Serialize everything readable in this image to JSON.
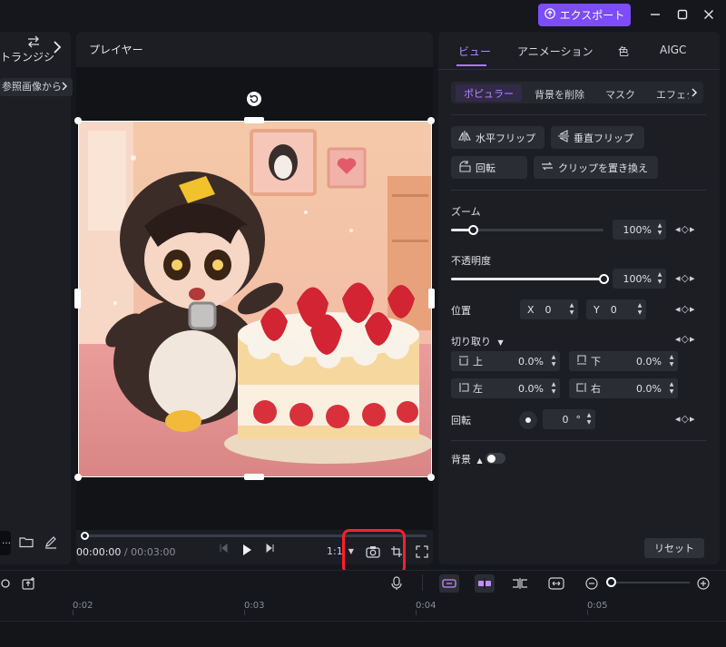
{
  "window": {
    "export_label": "エクスポート",
    "colors": {
      "accent": "#7c4dff",
      "tab_accent": "#b08cff",
      "highlight_box": "#ff1f2a"
    }
  },
  "left": {
    "transition_label": "トランジシ",
    "ref_chip": "参照画像から"
  },
  "player": {
    "title": "プレイヤー",
    "time_current": "00:00:00",
    "time_sep": "/",
    "time_total": "00:03:00",
    "ratio": "1:1",
    "scrub_progress": 0
  },
  "inspector": {
    "tabs": [
      "ビュー",
      "アニメーション",
      "色",
      "AIGC"
    ],
    "subtabs": [
      "ポピュラー",
      "背景を削除",
      "マスク",
      "エフェク"
    ],
    "buttons": {
      "flip_h": "水平フリップ",
      "flip_v": "垂直フリップ",
      "rotate": "回転",
      "replace_clip": "クリップを置き換え"
    },
    "zoom": {
      "label": "ズーム",
      "value": "100%",
      "level": 0.14
    },
    "opacity": {
      "label": "不透明度",
      "value": "100%",
      "level": 1.0
    },
    "position": {
      "label": "位置",
      "x_label": "X",
      "x_value": "0",
      "y_label": "Y",
      "y_value": "0"
    },
    "crop": {
      "label": "切り取り",
      "top_label": "上",
      "top_value": "0.0%",
      "bottom_label": "下",
      "bottom_value": "0.0%",
      "left_label": "左",
      "left_value": "0.0%",
      "right_label": "右",
      "right_value": "0.0%"
    },
    "rotation": {
      "label": "回転",
      "value": "0",
      "unit": "°"
    },
    "background": {
      "label": "背景"
    },
    "reset_label": "リセット"
  },
  "timeline": {
    "ticks": [
      "0:02",
      "0:03",
      "0:04",
      "0:05"
    ]
  }
}
